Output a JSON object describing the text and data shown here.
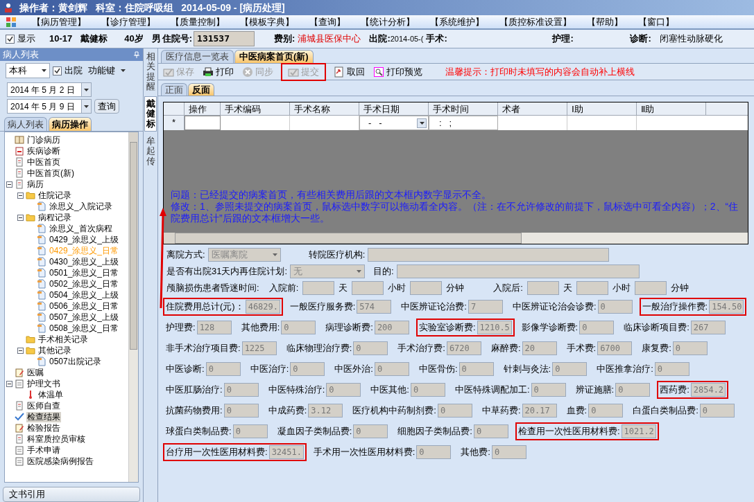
{
  "window": {
    "title": "操作者：黄剑辉   科室：住院呼吸组   2014-05-09 - [病历处理]"
  },
  "menu": [
    "【病历管理】",
    "【诊疗管理】",
    "【质量控制】",
    "【模板字典】",
    "【查询】",
    "【统计分析】",
    "【系统维护】",
    "【质控标准设置】",
    "【帮助】",
    "【窗口】"
  ],
  "patient_bar": {
    "show_label": "显示",
    "show_checked": true,
    "bed": "10-17",
    "name": "戴健标",
    "age": "40岁",
    "sex": "男",
    "admission_label": "住院号:",
    "admission_no": "131537",
    "fee_label": "费别:",
    "fee_type": "浦城县医保中心",
    "discharge_label": "出院:",
    "discharge": "2014-05-(",
    "surgery_label": "手术:",
    "nursing_label": "护理:",
    "diagnosis_label": "诊断:",
    "diagnosis": "闭塞性动脉硬化"
  },
  "left_panel": {
    "title": "病人列表",
    "scope": "本科",
    "discharged_label": "出院",
    "discharged_checked": true,
    "function_key": "功能键",
    "date_from": "2014 年 5 月 2 日",
    "date_to": "2014 年 5 月 9 日",
    "query_button": "查询",
    "tabs": [
      {
        "label": "病人列表",
        "selected": false
      },
      {
        "label": "病历操作",
        "selected": true
      }
    ],
    "tree": [
      {
        "label": "门诊病历",
        "kind": "book",
        "selected": false,
        "highlighted": false
      },
      {
        "label": "疾病诊断",
        "kind": "calendar",
        "selected": false,
        "highlighted": false
      },
      {
        "label": "中医首页",
        "kind": "doc",
        "selected": false,
        "highlighted": false
      },
      {
        "label": "中医首页(新)",
        "kind": "doc",
        "selected": false,
        "highlighted": false
      },
      {
        "label": "病历",
        "kind": "doc",
        "selected": false,
        "highlighted": false,
        "expanded": true,
        "children": [
          {
            "label": "住院记录",
            "kind": "folder",
            "selected": false,
            "highlighted": false,
            "expanded": true,
            "children": [
              {
                "label": "涂思义_入院记录",
                "kind": "page",
                "selected": false,
                "highlighted": false
              }
            ]
          },
          {
            "label": "病程记录",
            "kind": "folder",
            "selected": false,
            "highlighted": false,
            "expanded": true,
            "children": [
              {
                "label": "涂思义_首次病程",
                "kind": "page",
                "selected": false,
                "highlighted": false
              },
              {
                "label": "0429_涂思义_上级",
                "kind": "page",
                "selected": false,
                "highlighted": false
              },
              {
                "label": "0429_涂思义_日常",
                "kind": "page",
                "selected": false,
                "highlighted": true
              },
              {
                "label": "0430_涂思义_上级",
                "kind": "page",
                "selected": false,
                "highlighted": false
              },
              {
                "label": "0501_涂思义_日常",
                "kind": "page",
                "selected": false,
                "highlighted": false
              },
              {
                "label": "0502_涂思义_日常",
                "kind": "page",
                "selected": false,
                "highlighted": false
              },
              {
                "label": "0504_涂思义_上级",
                "kind": "page",
                "selected": false,
                "highlighted": false
              },
              {
                "label": "0506_涂思义_日常",
                "kind": "page",
                "selected": false,
                "highlighted": false
              },
              {
                "label": "0507_涂思义_上级",
                "kind": "page",
                "selected": false,
                "highlighted": false
              },
              {
                "label": "0508_涂思义_日常",
                "kind": "page",
                "selected": false,
                "highlighted": false
              }
            ]
          },
          {
            "label": "手术相关记录",
            "kind": "folder",
            "selected": false,
            "highlighted": false
          },
          {
            "label": "其他记录",
            "kind": "folder",
            "selected": false,
            "highlighted": false,
            "expanded": true,
            "children": [
              {
                "label": "0507出院记录",
                "kind": "page",
                "selected": false,
                "highlighted": false
              }
            ]
          }
        ]
      },
      {
        "label": "医嘱",
        "kind": "note",
        "selected": false,
        "highlighted": false
      },
      {
        "label": "护理文书",
        "kind": "clipboard",
        "selected": false,
        "highlighted": false,
        "expanded": true,
        "children": [
          {
            "label": "体温单",
            "kind": "thermometer",
            "selected": false,
            "highlighted": false
          }
        ]
      },
      {
        "label": "医师自查",
        "kind": "doc",
        "selected": false,
        "highlighted": false
      },
      {
        "label": "检查结果",
        "kind": "check",
        "selected": true,
        "highlighted": false
      },
      {
        "label": "检验报告",
        "kind": "note",
        "selected": false,
        "highlighted": false
      },
      {
        "label": "科室质控员审核",
        "kind": "doc",
        "selected": false,
        "highlighted": false
      },
      {
        "label": "手术申请",
        "kind": "clipboard",
        "selected": false,
        "highlighted": false
      },
      {
        "label": "医院感染病例报告",
        "kind": "clipboard",
        "selected": false,
        "highlighted": false
      }
    ],
    "bottom_button": "文书引用"
  },
  "side_tabs": [
    {
      "label": "相关提醒",
      "selected": false
    },
    {
      "label": "戴健标",
      "selected": true
    },
    {
      "label": "牟起传",
      "selected": false
    }
  ],
  "doc_tabs": [
    {
      "label": "医疗信息一览表",
      "selected": false
    },
    {
      "label": "中医病案首页(新)",
      "selected": true
    }
  ],
  "toolbar": [
    {
      "label": "保存",
      "kind": "check",
      "disabled": true,
      "flagged": false
    },
    {
      "label": "打印",
      "kind": "printer",
      "disabled": false,
      "flagged": false
    },
    {
      "label": "同步",
      "kind": "x",
      "disabled": true,
      "flagged": false
    },
    {
      "label": "提交",
      "kind": "check",
      "disabled": true,
      "flagged": true
    },
    {
      "label": "取回",
      "kind": "fetch",
      "disabled": false,
      "flagged": false
    },
    {
      "label": "打印预览",
      "kind": "preview",
      "disabled": false,
      "flagged": false
    }
  ],
  "tip": "温馨提示：打印时未填写的内容会自动补上横线",
  "page_tabs": [
    {
      "label": "正面",
      "selected": false
    },
    {
      "label": "反面",
      "selected": true
    }
  ],
  "surgery_table": {
    "columns": [
      "操作",
      "手术编码",
      "手术名称",
      "手术日期",
      "手术时间",
      "术者",
      "Ⅰ助",
      "Ⅱ助"
    ],
    "new_row_marker": "*",
    "date_placeholder": "-   -",
    "time_placeholder": ":   ;"
  },
  "annotation": {
    "problem": "问题：已经提交的病案首页，有些相关费用后跟的文本框内数字显示不全。",
    "fix": "修改：1、参照未提交的病案首页，鼠标选中数字可以拖动看全内容。（注：在不允许修改的前提下，鼠标选中可看全内容）；2、“住院费用总计”后跟的文本框增大一些。"
  },
  "discharge": {
    "method_label": "离院方式:",
    "method": "医嘱离院",
    "transfer_label": "转院医疗机构:",
    "readmit_label": "是否有出院31天内再住院计划:",
    "readmit": "无",
    "purpose_label": "目的:",
    "coma_label": "颅脑损伤患者昏迷时间:",
    "before_label": "入院前:",
    "before_day": "天",
    "before_hour": "小时",
    "before_minute": "分钟",
    "after_label": "入院后:",
    "after_day": "天",
    "after_hour": "小时",
    "after_minute": "分钟"
  },
  "fees": [
    [
      {
        "label": "住院费用总计(元)：",
        "value": "46829.",
        "flagged": true
      },
      {
        "label": "一般医疗服务费:",
        "value": "574",
        "flagged": false
      },
      {
        "label": "中医辨证论治费:",
        "value": "7",
        "flagged": false
      },
      {
        "label": "中医辨证论治会诊费:",
        "value": "0",
        "flagged": false
      },
      {
        "label": "一般治疗操作费:",
        "value": "154.50",
        "flagged": true
      }
    ],
    [
      {
        "label": "护理费:",
        "value": "128",
        "flagged": false
      },
      {
        "label": "其他费用:",
        "value": "0",
        "flagged": false
      },
      {
        "label": "病理诊断费:",
        "value": "200",
        "flagged": false
      },
      {
        "label": "实验室诊断费:",
        "value": "1210.5",
        "flagged": true
      },
      {
        "label": "影像学诊断费:",
        "value": "0",
        "flagged": false
      },
      {
        "label": "临床诊断项目费:",
        "value": "267",
        "flagged": false
      }
    ],
    [
      {
        "label": "非手术治疗项目费:",
        "value": "1225",
        "flagged": false
      },
      {
        "label": "临床物理治疗费:",
        "value": "0",
        "flagged": false
      },
      {
        "label": "手术治疗费:",
        "value": "6720",
        "flagged": false
      },
      {
        "label": "麻醉费:",
        "value": "20",
        "flagged": false
      },
      {
        "label": "手术费:",
        "value": "6700",
        "flagged": false
      },
      {
        "label": "康复费:",
        "value": "0",
        "flagged": false
      }
    ],
    [
      {
        "label": "中医诊断:",
        "value": "0",
        "flagged": false
      },
      {
        "label": "中医治疗:",
        "value": "0",
        "flagged": false
      },
      {
        "label": "中医外治:",
        "value": "0",
        "flagged": false
      },
      {
        "label": "中医骨伤:",
        "value": "0",
        "flagged": false
      },
      {
        "label": "针刺与灸法:",
        "value": "0",
        "flagged": false
      },
      {
        "label": "中医推拿治疗:",
        "value": "0",
        "flagged": false
      }
    ],
    [
      {
        "label": "中医肛肠治疗:",
        "value": "0",
        "flagged": false
      },
      {
        "label": "中医特殊治疗:",
        "value": "0",
        "flagged": false
      },
      {
        "label": "中医其他:",
        "value": "0",
        "flagged": false
      },
      {
        "label": "中医特殊调配加工:",
        "value": "0",
        "flagged": false
      },
      {
        "label": "辨证施膳:",
        "value": "0",
        "flagged": false
      },
      {
        "label": "西药费:",
        "value": "2854.2",
        "flagged": true
      }
    ],
    [
      {
        "label": "抗菌药物费用:",
        "value": "0",
        "flagged": false
      },
      {
        "label": "中成药费:",
        "value": "3.12",
        "flagged": false
      },
      {
        "label": "医疗机构中药制剂费:",
        "value": "0",
        "flagged": false
      },
      {
        "label": "中草药费:",
        "value": "20.17",
        "flagged": false
      },
      {
        "label": "血费:",
        "value": "0",
        "flagged": false
      },
      {
        "label": "白蛋白类制品费:",
        "value": "0",
        "flagged": false
      }
    ],
    [
      {
        "label": "球蛋白类制品费:",
        "value": "0",
        "flagged": false
      },
      {
        "label": "凝血因子类制品费:",
        "value": "0",
        "flagged": false
      },
      {
        "label": "细胞因子类制品费:",
        "value": "0",
        "flagged": false
      },
      {
        "label": "检查用一次性医用材料费:",
        "value": "1021.2",
        "flagged": true
      }
    ],
    [
      {
        "label": "台疗用一次性医用材料费:",
        "value": "32451.",
        "flagged": true
      },
      {
        "label": "手术用一次性医用材料费:",
        "value": "0",
        "flagged": false
      },
      {
        "label": "其他费:",
        "value": "0",
        "flagged": false
      }
    ]
  ]
}
